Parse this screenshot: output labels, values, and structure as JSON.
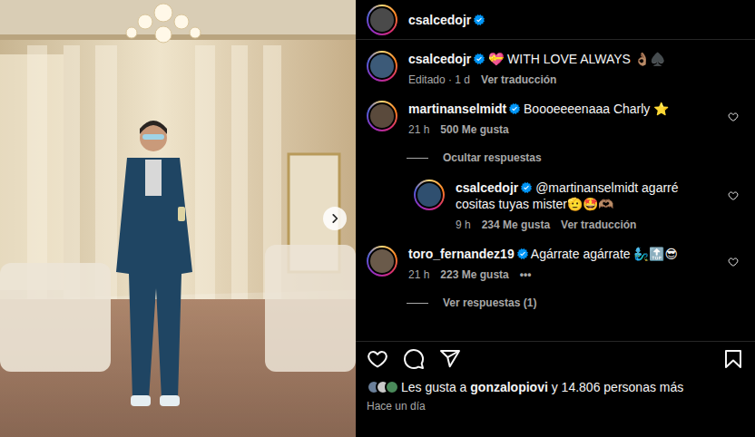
{
  "header": {
    "username": "csalcedojr",
    "verified": true,
    "story_ring": true
  },
  "caption": {
    "username": "csalcedojr",
    "verified": true,
    "story_ring": true,
    "text": "💝 WITH LOVE ALWAYS 👌🏽♠️",
    "meta": "Editado · 1 d",
    "translate": "Ver traducción"
  },
  "comments": [
    {
      "username": "martinanselmidt",
      "verified": true,
      "story_ring": true,
      "text": "Boooeeeenaaa Charly ⭐",
      "time": "21 h",
      "likes": "500 Me gusta",
      "liked": false,
      "replies_toggle": "Ocultar respuestas",
      "expanded": true,
      "replies": [
        {
          "username": "csalcedojr",
          "verified": true,
          "story_ring": true,
          "text": "@martinanselmidt agarré cositas tuyas mister🫡🤩🫶🏽",
          "time": "9 h",
          "likes": "234 Me gusta",
          "translate": "Ver traducción",
          "liked": false
        }
      ]
    },
    {
      "username": "toro_fernandez19",
      "verified": true,
      "story_ring": true,
      "text": "Agárrate agárrate 🧞‍♂️🔝😎",
      "time": "21 h",
      "likes": "223 Me gusta",
      "more": "•••",
      "liked": false,
      "replies_toggle": "Ver respuestas (1)",
      "expanded": false,
      "replies": []
    }
  ],
  "post": {
    "liked": false,
    "saved": false
  },
  "likes": {
    "prefix": "Les gusta a ",
    "user": "gonzalopiovi",
    "suffix": " y 14.806 personas más"
  },
  "time": "Hace un día"
}
